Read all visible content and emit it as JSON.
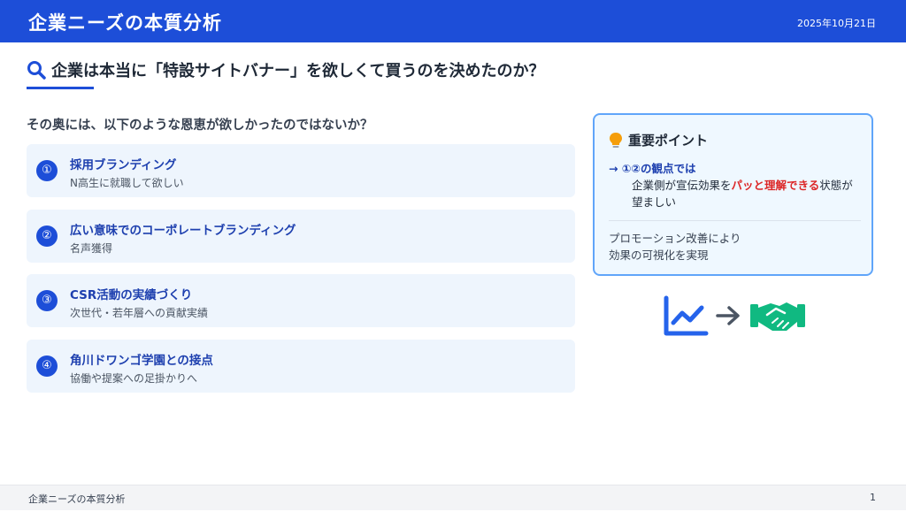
{
  "header": {
    "title": "企業ニーズの本質分析",
    "date": "2025年10月21日"
  },
  "question": {
    "icon": "search-icon",
    "text": "企業は本当に「特設サイトバナー」を欲しくて買うのを決めたのか？"
  },
  "subtitle": "その奥には、以下のような恩恵が欲しかったのではないか？",
  "benefits": [
    {
      "num": "①",
      "title": "採用ブランディング",
      "desc": "N高生に就職して欲しい"
    },
    {
      "num": "②",
      "title": "広い意味でのコーポレートブランディング",
      "desc": "名声獲得"
    },
    {
      "num": "③",
      "title": "CSR活動の実績づくり",
      "desc": "次世代・若年層への貢献実績"
    },
    {
      "num": "④",
      "title": "角川ドワンゴ学園との接点",
      "desc": "協働や提案への足掛かりへ"
    }
  ],
  "key_point": {
    "icon": "lightbulb-icon",
    "title": "重要ポイント",
    "line1": "→ ①②の観点では",
    "body_pre": "企業側が宣伝効果を",
    "body_highlight": "パッと理解できる",
    "body_post": "状態が望ましい",
    "note_line1": "プロモーション改善により",
    "note_line2": "効果の可視化を実現"
  },
  "icons": {
    "chart": "line-chart-icon",
    "arrow": "arrow-right-icon",
    "handshake": "handshake-icon",
    "chart_color": "#2563eb",
    "arrow_color": "#4b5563",
    "handshake_color": "#10b981"
  },
  "footer": {
    "title": "企業ニーズの本質分析",
    "page": "1"
  }
}
